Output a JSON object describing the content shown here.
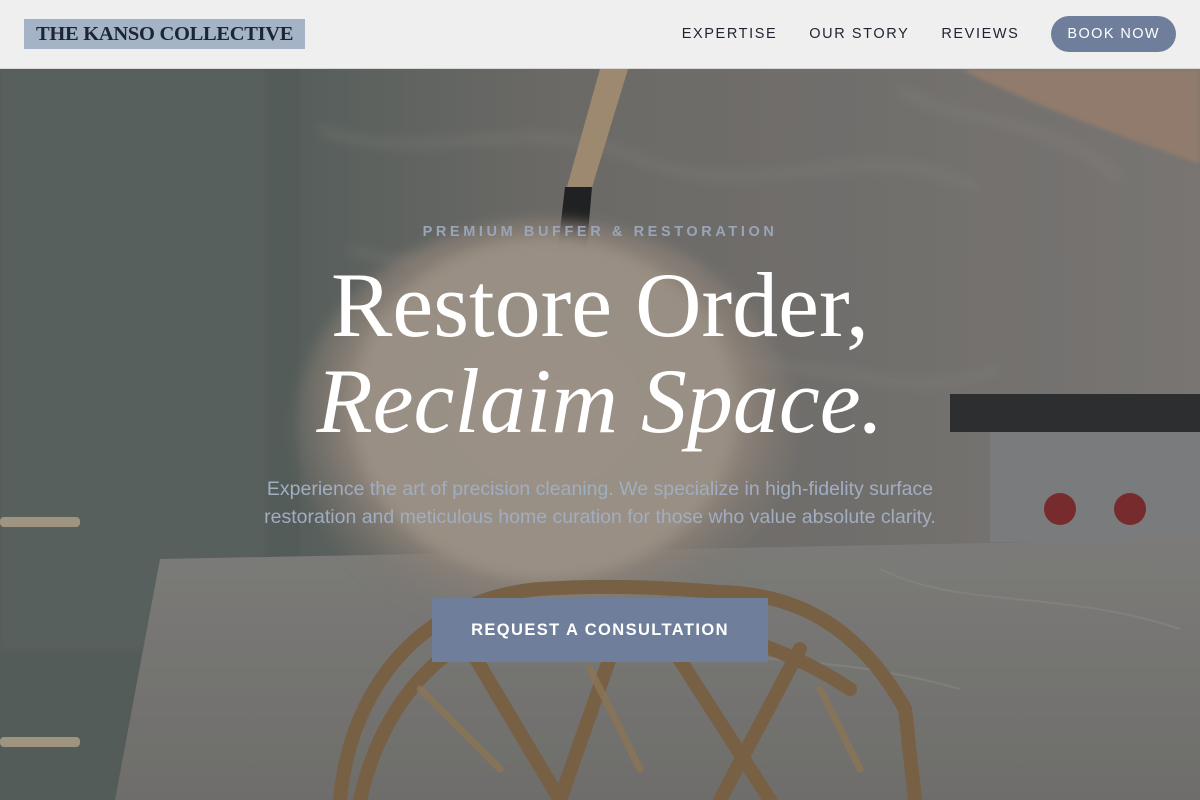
{
  "brand": {
    "name": "THE KANSO COLLECTIVE"
  },
  "nav": {
    "items": [
      {
        "label": "EXPERTISE"
      },
      {
        "label": "OUR STORY"
      },
      {
        "label": "REVIEWS"
      }
    ],
    "cta_label": "BOOK NOW"
  },
  "hero": {
    "eyebrow": "PREMIUM BUFFER & RESTORATION",
    "headline_line1": "Restore Order,",
    "headline_line2": "Reclaim Space.",
    "description": "Experience the art of precision cleaning. We specialize in high-fidelity surface restoration and meticulous home curation for those who value absolute clarity.",
    "cta_label": "REQUEST A CONSULTATION",
    "background_image": "feather-duster-kitchen-photo"
  },
  "colors": {
    "accent": "#6f7f9b",
    "logo_bg": "#a4b3c6",
    "header_bg": "#efefef",
    "eyebrow": "#9aa5b7",
    "description": "#a1adc0",
    "headline": "#ffffff"
  }
}
